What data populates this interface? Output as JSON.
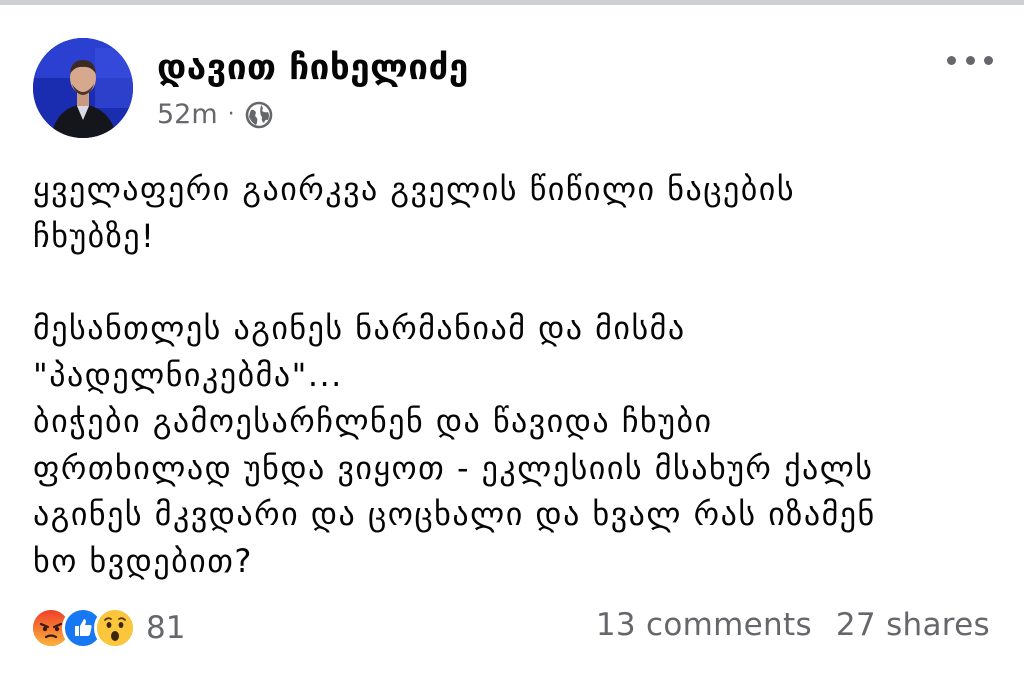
{
  "post": {
    "author": "დავით ჩიხელიძე",
    "time": "52m",
    "separator": "·",
    "privacy_icon": "globe-icon",
    "more_icon": "more-options-icon",
    "text": {
      "para1": [
        "ყველაფერი გაირკვა გველის წიწილი ნაცების",
        "ჩხუბზე!"
      ],
      "para2": [
        "მესანთლეს აგინეს ნარმანიამ და მისმა",
        "\"პადელნიკებმა\"...",
        "ბიჭები გამოესარჩლნენ და წავიდა ჩხუბი",
        "ფრთხილად უნდა ვიყოთ - ეკლესიის მსახურ ქალს",
        "აგინეს მკვდარი და ცოცხალი და ხვალ რას იზამენ",
        "ხო ხვდებით?"
      ]
    }
  },
  "footer": {
    "reactions": [
      "angry",
      "like",
      "wow"
    ],
    "reaction_count": "81",
    "comments": "13 comments",
    "shares": "27 shares"
  },
  "colors": {
    "secondary_text": "#65676b",
    "like_blue": "#1877f2",
    "angry_orange": "#f25c27",
    "wow_yellow": "#fcc63c"
  }
}
